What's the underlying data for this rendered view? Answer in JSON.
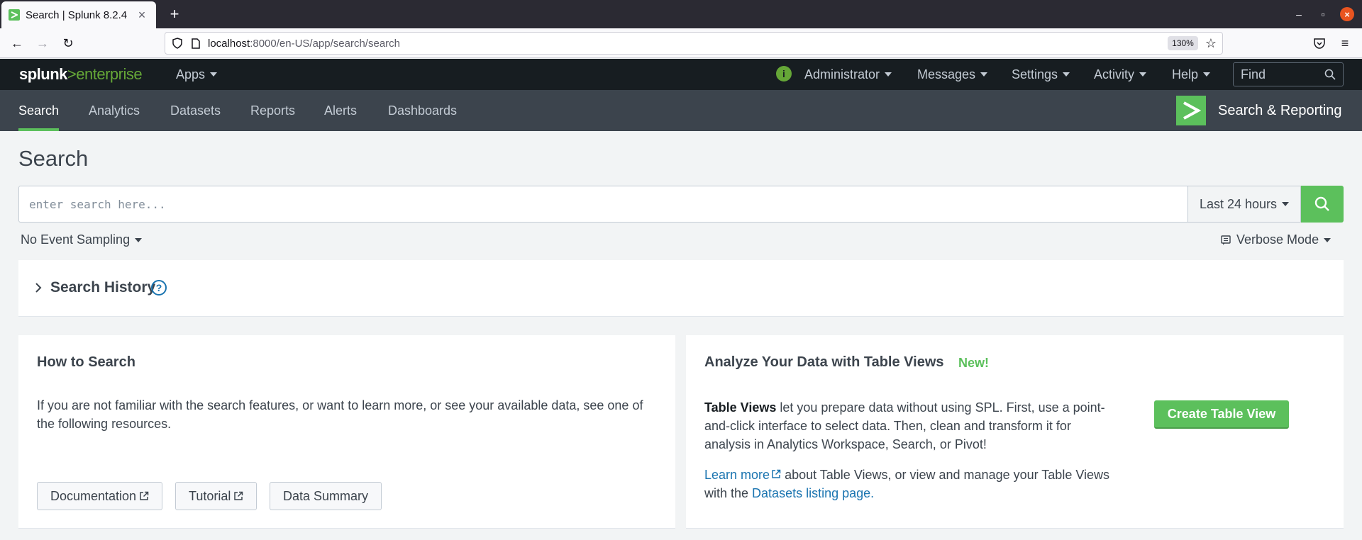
{
  "browser": {
    "tab_title": "Search | Splunk 8.2.4",
    "url_host": "localhost",
    "url_path": ":8000/en-US/app/search/search",
    "zoom": "130%"
  },
  "header": {
    "logo_splunk": "splunk",
    "logo_gt": ">",
    "logo_enterprise": "enterprise",
    "apps": "Apps",
    "user": "Administrator",
    "messages": "Messages",
    "settings": "Settings",
    "activity": "Activity",
    "help": "Help",
    "find_placeholder": "Find"
  },
  "appbar": {
    "tabs": [
      "Search",
      "Analytics",
      "Datasets",
      "Reports",
      "Alerts",
      "Dashboards"
    ],
    "active_tab": "Search",
    "app_title": "Search & Reporting"
  },
  "main": {
    "page_title": "Search",
    "search_placeholder": "enter search here...",
    "time_range": "Last 24 hours",
    "event_sampling": "No Event Sampling",
    "search_mode": "Verbose Mode",
    "search_history": "Search History"
  },
  "how_to": {
    "title": "How to Search",
    "text": "If you are not familiar with the search features, or want to learn more, or see your available data, see one of the following resources.",
    "buttons": [
      "Documentation",
      "Tutorial",
      "Data Summary"
    ]
  },
  "table_views": {
    "title": "Analyze Your Data with Table Views",
    "badge": "New!",
    "bold": "Table Views",
    "text": " let you prepare data without using SPL. First, use a point-and-click interface to select data. Then, clean and transform it for analysis in Analytics Workspace, Search, or Pivot!",
    "learn_more": "Learn more",
    "learn_text": " about Table Views, or view and manage your Table Views with the ",
    "datasets_link": "Datasets listing page.",
    "create_button": "Create Table View"
  },
  "colors": {
    "splunk_green": "#5cc05c",
    "header_dark": "#171d21",
    "appbar": "#3c444d",
    "link": "#1a74b0"
  }
}
